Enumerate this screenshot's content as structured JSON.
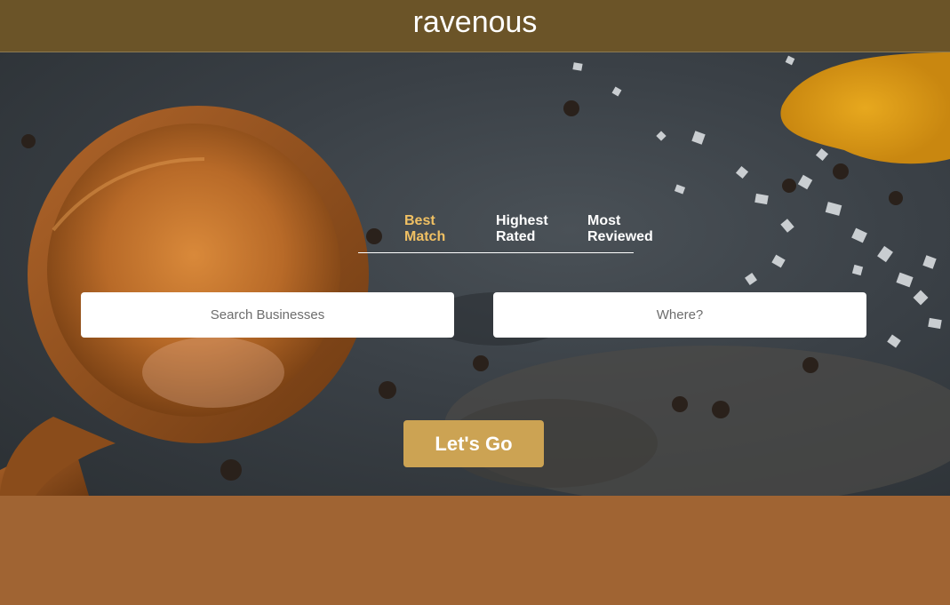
{
  "header": {
    "brand": "ravenous"
  },
  "sort_options": [
    {
      "label": "Best\nMatch",
      "active": true
    },
    {
      "label": "Highest\nRated",
      "active": false
    },
    {
      "label": "Most\nReviewed",
      "active": false
    }
  ],
  "search": {
    "term_placeholder": "Search Businesses",
    "term_value": "",
    "location_placeholder": "Where?",
    "location_value": ""
  },
  "submit": {
    "label": "Let's Go"
  },
  "colors": {
    "header_bg": "#6b5428",
    "active_sort": "#f0c063",
    "button_bg": "#cca353",
    "footer_bg": "#a06433"
  }
}
